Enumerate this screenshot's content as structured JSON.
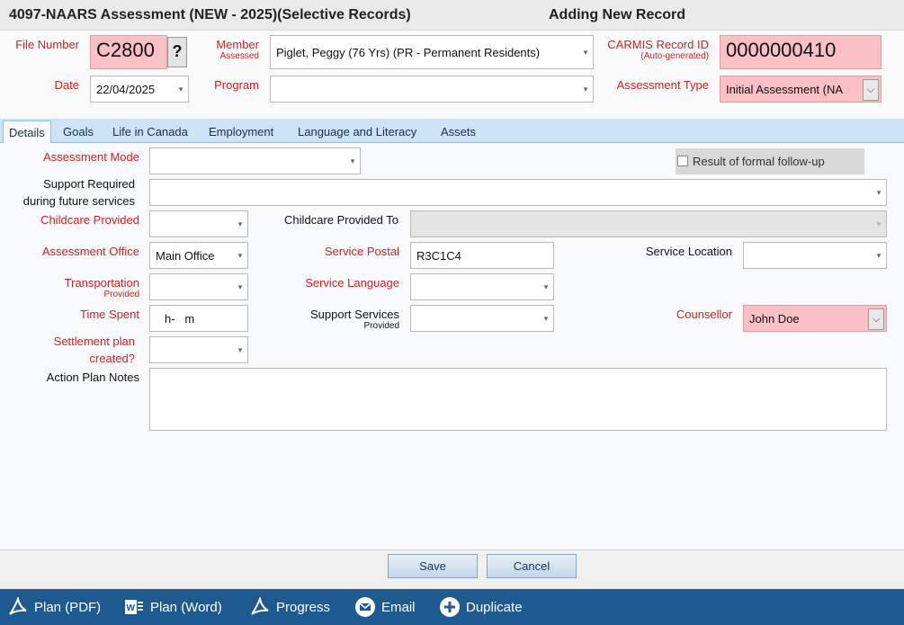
{
  "window": {
    "title": "4097-NAARS Assessment (NEW - 2025)(Selective Records)",
    "mode": "Adding New Record"
  },
  "header": {
    "file_number_label": "File Number",
    "file_number": "C2800",
    "help_button": "?",
    "member_label": "Member",
    "member_sublabel": "Assessed",
    "member": "Piglet, Peggy (76 Yrs) (PR - Permanent Residents)",
    "carmis_label": "CARMIS Record ID",
    "carmis_sublabel": "(Auto-generated)",
    "carmis_id": "0000000410",
    "date_label": "Date",
    "date": "22/04/2025",
    "program_label": "Program",
    "program": "",
    "assessment_type_label": "Assessment Type",
    "assessment_type": "Initial Assessment (NA"
  },
  "tabs": [
    "Details",
    "Goals",
    "Life in Canada",
    "Employment",
    "Language and Literacy",
    "Assets"
  ],
  "details": {
    "assessment_mode_label": "Assessment Mode",
    "assessment_mode": "",
    "formal_followup_label": "Result of formal follow-up",
    "support_required_label_1": "Support Required",
    "support_required_label_2": "during future services",
    "support_required": "",
    "childcare_provided_label": "Childcare Provided",
    "childcare_provided": "",
    "childcare_provided_to_label": "Childcare Provided To",
    "childcare_provided_to": "",
    "assessment_office_label": "Assessment Office",
    "assessment_office": "Main Office",
    "service_postal_label": "Service Postal",
    "service_postal": "R3C1C4",
    "service_location_label": "Service Location",
    "service_location": "",
    "transportation_label": "Transportation",
    "transportation_sublabel": "Provided",
    "transportation": "",
    "service_language_label": "Service Language",
    "service_language": "",
    "time_spent_label": "Time Spent",
    "time_spent": "h-   m",
    "support_services_label": "Support Services",
    "support_services_sublabel": "Provided",
    "support_services": "",
    "counsellor_label": "Counsellor",
    "counsellor": "John Doe",
    "settlement_label_1": "Settlement plan",
    "settlement_label_2": "created?",
    "settlement": "",
    "action_notes_label": "Action Plan Notes",
    "action_notes": ""
  },
  "buttons": {
    "save": "Save",
    "cancel": "Cancel"
  },
  "toolbar": {
    "plan_pdf": "Plan (PDF)",
    "plan_word": "Plan (Word)",
    "progress": "Progress",
    "email": "Email",
    "duplicate": "Duplicate"
  },
  "colors": {
    "required_label": "#d42020",
    "required_field": "#fbbfc6",
    "toolbar": "#1e5a8f",
    "tab_bar": "#cfe3f7"
  }
}
